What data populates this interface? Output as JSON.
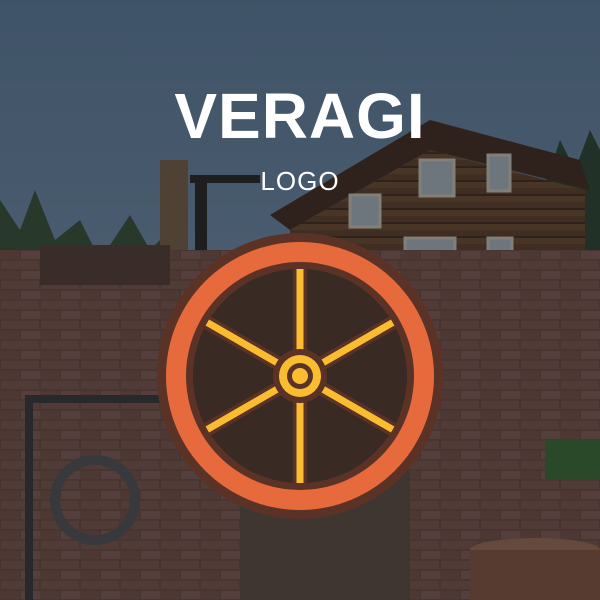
{
  "brand": {
    "name": "VERAGI",
    "tagline": "LOGO"
  },
  "logo": {
    "icon": "wagon-wheel-icon",
    "colors": {
      "outline": "#5b3226",
      "rim": "#e66a3c",
      "spokes": "#fbbd30"
    }
  },
  "background": {
    "overlay_color": "#14181e"
  }
}
